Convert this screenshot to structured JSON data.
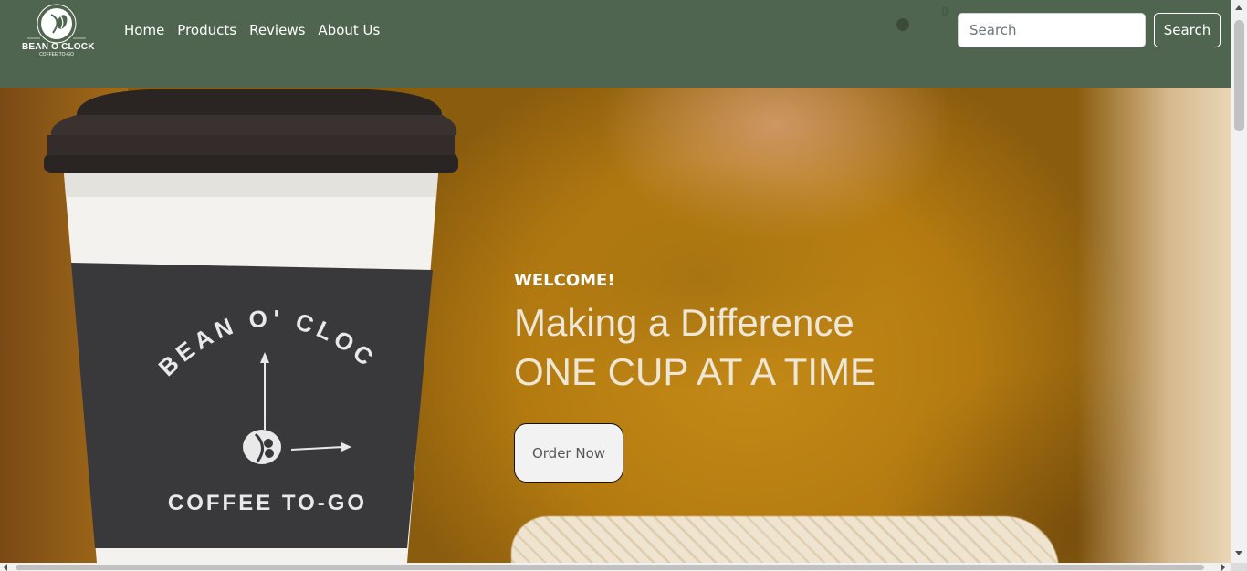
{
  "brand": {
    "name": "BEAN O CLOCK",
    "tagline": "COFFEE TO-GO"
  },
  "nav": {
    "links": [
      "Home",
      "Products",
      "Reviews",
      "About Us"
    ]
  },
  "cart": {
    "count": "0"
  },
  "search": {
    "placeholder": "Search",
    "button_label": "Search"
  },
  "hero": {
    "eyebrow": "WELCOME!",
    "headline_line1": "Making a Difference",
    "headline_line2": "ONE CUP AT A TIME",
    "cta_label": "Order Now",
    "cup_sleeve_brand": "BEAN O' CLOCK",
    "cup_sleeve_tagline": "COFFEE TO-GO"
  },
  "colors": {
    "navbar_bg": "#50654f",
    "headline_text": "#efe7d5",
    "cta_bg": "#f2f2f2"
  }
}
